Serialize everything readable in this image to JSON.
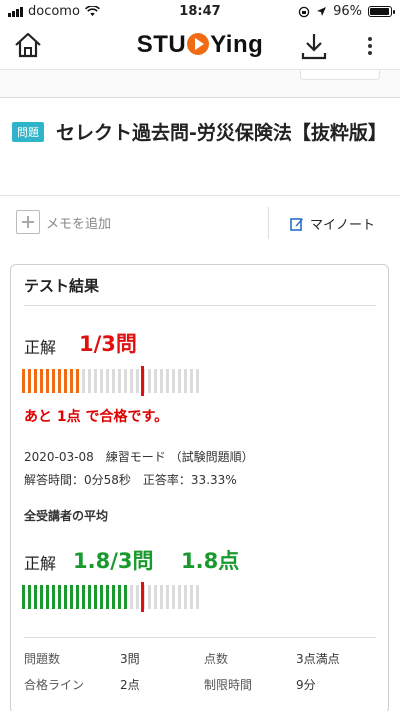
{
  "status": {
    "carrier": "docomo",
    "time": "18:47",
    "battery": "96%",
    "battery_level": 0.96
  },
  "header": {
    "home_icon": "home-icon",
    "logo": {
      "prefix": "STU",
      "suffix": "Ying"
    },
    "download_icon": "download-icon",
    "more_icon": "more-vertical-icon"
  },
  "question": {
    "badge": "問題",
    "title": "セレクト過去問-労災保険法【抜粋版】"
  },
  "memo": {
    "add_label": "メモを追加",
    "mynote_label": "マイノート"
  },
  "result": {
    "heading": "テスト結果",
    "score_label": "正解",
    "score_text": "1/3問",
    "correct": 1,
    "total": 3,
    "pass_line": 2,
    "remaining_msg": "あと 1点 で合格です。",
    "date": "2020-03-08",
    "mode": "練習モード （試験問題順）",
    "time_label": "解答時間：0分58秒",
    "rate_label": "正答率：33.33%",
    "avg_heading": "全受講者の平均",
    "avg_score_label": "正解",
    "avg_score_text": "1.8/3問",
    "avg_points_text": "1.8点",
    "avg_correct": 1.8
  },
  "stats": {
    "q_count_label": "問題数",
    "q_count": "3問",
    "points_label": "点数",
    "points": "3点満点",
    "pass_label": "合格ライン",
    "pass": "2点",
    "limit_label": "制限時間",
    "limit": "9分"
  },
  "colors": {
    "accent_orange": "#f06c14",
    "red": "#e01010",
    "green": "#1a9a2e",
    "badge": "#30b4c9"
  }
}
